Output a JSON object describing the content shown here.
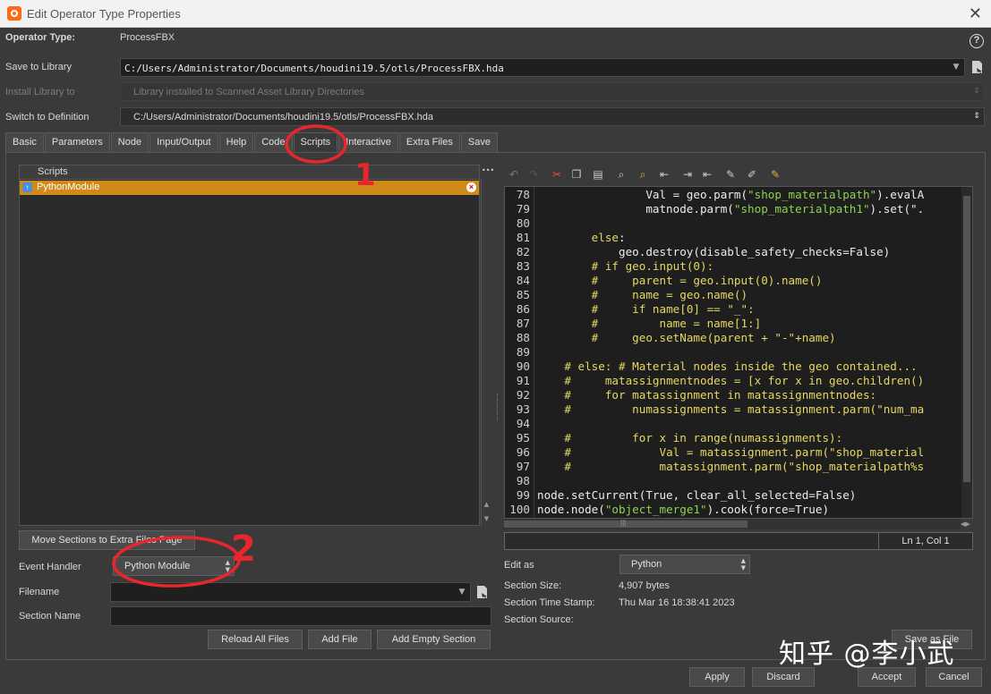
{
  "window": {
    "title": "Edit Operator Type Properties"
  },
  "header": {
    "operator_type_label": "Operator Type:",
    "operator_type_value": "ProcessFBX",
    "save_to_library_label": "Save to Library",
    "save_to_library_value": "C:/Users/Administrator/Documents/houdini19.5/otls/ProcessFBX.hda",
    "install_library_label": "Install Library to",
    "install_library_value": "Library installed to Scanned Asset Library Directories",
    "switch_definition_label": "Switch to Definition",
    "switch_definition_value": "C:/Users/Administrator/Documents/houdini19.5/otls/ProcessFBX.hda"
  },
  "tabs": [
    "Basic",
    "Parameters",
    "Node",
    "Input/Output",
    "Help",
    "Code",
    "Scripts",
    "Interactive",
    "Extra Files",
    "Save"
  ],
  "active_tab": "Scripts",
  "scripts_panel": {
    "column_header": "Scripts",
    "items": [
      "PythonModule"
    ],
    "move_sections_button": "Move Sections to Extra Files Page",
    "event_handler_label": "Event Handler",
    "event_handler_value": "Python Module",
    "filename_label": "Filename",
    "filename_value": "",
    "section_name_label": "Section Name",
    "section_name_value": "",
    "reload_all_files_button": "Reload All Files",
    "add_file_button": "Add File",
    "add_empty_section_button": "Add Empty Section"
  },
  "editor": {
    "lines": [
      {
        "n": "78",
        "t": "                Val = geo.parm(\"shop_materialpath\").evalA"
      },
      {
        "n": "79",
        "t": "                matnode.parm(\"shop_materialpath1\").set(\"."
      },
      {
        "n": "80",
        "t": ""
      },
      {
        "n": "81",
        "t": "        else:"
      },
      {
        "n": "82",
        "t": "            geo.destroy(disable_safety_checks=False)"
      },
      {
        "n": "83",
        "t": "        # if geo.input(0):"
      },
      {
        "n": "84",
        "t": "        #     parent = geo.input(0).name()"
      },
      {
        "n": "85",
        "t": "        #     name = geo.name()"
      },
      {
        "n": "86",
        "t": "        #     if name[0] == \"_\":"
      },
      {
        "n": "87",
        "t": "        #         name = name[1:]"
      },
      {
        "n": "88",
        "t": "        #     geo.setName(parent + \"-\"+name)"
      },
      {
        "n": "89",
        "t": ""
      },
      {
        "n": "90",
        "t": "    # else: # Material nodes inside the geo contained..."
      },
      {
        "n": "91",
        "t": "    #     matassignmentnodes = [x for x in geo.children()"
      },
      {
        "n": "92",
        "t": "    #     for matassignment in matassignmentnodes:"
      },
      {
        "n": "93",
        "t": "    #         numassignments = matassignment.parm(\"num_ma"
      },
      {
        "n": "94",
        "t": ""
      },
      {
        "n": "95",
        "t": "    #         for x in range(numassignments):"
      },
      {
        "n": "96",
        "t": "    #             Val = matassignment.parm(\"shop_material"
      },
      {
        "n": "97",
        "t": "    #             matassignment.parm(\"shop_materialpath%s"
      },
      {
        "n": "98",
        "t": ""
      },
      {
        "n": "99",
        "t": "node.setCurrent(True, clear_all_selected=False)"
      },
      {
        "n": "100",
        "t": "node.node(\"object_merge1\").cook(force=True)"
      }
    ],
    "cursor_position": "Ln 1, Col 1",
    "edit_as_label": "Edit as",
    "edit_as_value": "Python",
    "section_size_label": "Section Size:",
    "section_size_value": "4,907 bytes",
    "section_time_label": "Section Time Stamp:",
    "section_time_value": "Thu Mar 16 18:38:41 2023",
    "section_source_label": "Section Source:",
    "save_as_file_button": "Save as File"
  },
  "footer": {
    "apply_button": "Apply",
    "discard_button": "Discard",
    "accept_button": "Accept",
    "cancel_button": "Cancel"
  },
  "annotations": {
    "mark_1": "1",
    "mark_2": "2"
  },
  "watermark": "知乎 @李小武",
  "colors": {
    "selection": "#d18a17",
    "annotation": "#e8262b",
    "keyword": "#e6d760",
    "string": "#8fd14f"
  }
}
